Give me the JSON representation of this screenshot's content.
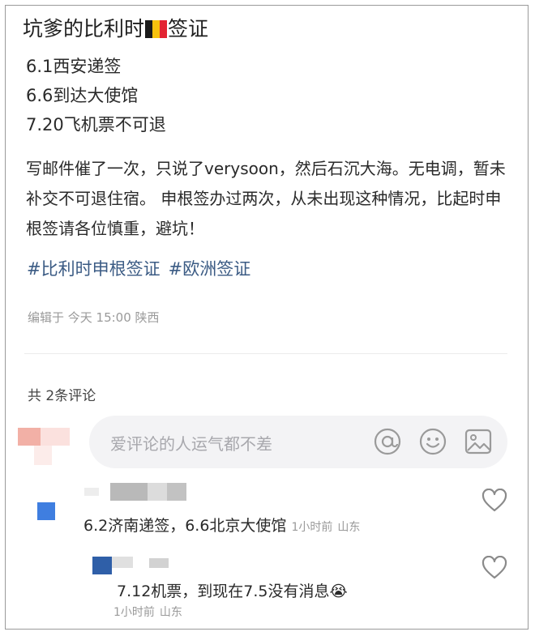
{
  "post": {
    "title_before_flag": "坑爹的比利时",
    "title_after_flag": "签证",
    "flag_colors": [
      "#1b1b1b",
      "#f7c20e",
      "#e32432"
    ],
    "lines": [
      "6.1西安递签",
      "6.6到达大使馆",
      "7.20飞机票不可退"
    ],
    "paragraph": "写邮件催了一次，只说了verysoon，然后石沉大海。无电调，暂未补交不可退住宿。 申根签办过两次，从未出现这种情况，比起时申根签请各位慎重，避坑！",
    "tags": [
      "#比利时申根签证",
      "#欧洲签证"
    ],
    "meta": "编辑于 今天 15:00 陕西"
  },
  "comments_section": {
    "count_label": "共 2条评论",
    "input_placeholder": "爱评论的人运气都不差",
    "input_icons": [
      "at-icon",
      "emoji-icon",
      "image-icon"
    ],
    "comments": [
      {
        "text": "6.2济南递签，6.6北京大使馆",
        "time": "1小时前",
        "location": "山东"
      },
      {
        "text": "7.12机票，到现在7.5没有消息",
        "emoji": "😭",
        "time": "1小时前",
        "location": "山东"
      }
    ]
  },
  "colors": {
    "tag": "#3b5b84",
    "meta": "#9a9a9a",
    "input_bg": "#f3f3f5",
    "placeholder": "#a8a8ad"
  }
}
